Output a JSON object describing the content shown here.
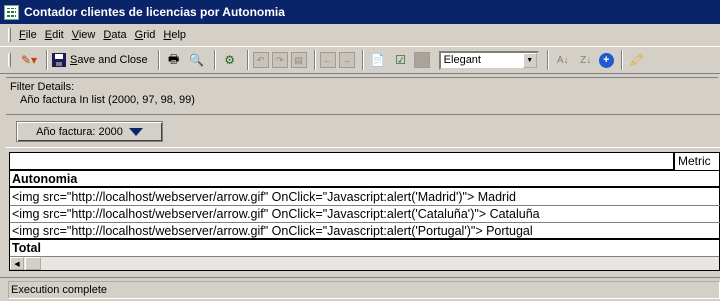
{
  "window": {
    "title": "Contador clientes de licencias por Autonomia"
  },
  "menu": {
    "items": [
      {
        "key": "F",
        "rest": "ile"
      },
      {
        "key": "E",
        "rest": "dit"
      },
      {
        "key": "V",
        "rest": "iew"
      },
      {
        "key": "D",
        "rest": "ata"
      },
      {
        "key": "G",
        "rest": "rid"
      },
      {
        "key": "H",
        "rest": "elp"
      }
    ]
  },
  "toolbar": {
    "save_close_key": "S",
    "save_close_rest": "ave and Close",
    "style_value": "Elegant"
  },
  "filter": {
    "label": "Filter Details:",
    "value": "Año factura In list (2000, 97, 98, 99)"
  },
  "page_by": {
    "label": "Año factura: 2000"
  },
  "grid": {
    "metric_header": "Metric",
    "row_header": "Autonomia",
    "rows": [
      "<img src=\"http://localhost/webserver/arrow.gif\" OnClick=\"Javascript:alert('Madrid')\"> Madrid",
      "<img src=\"http://localhost/webserver/arrow.gif\" OnClick=\"Javascript:alert('Cataluña')\"> Cataluña",
      "<img src=\"http://localhost/webserver/arrow.gif\" OnClick=\"Javascript:alert('Portugal')\"> Portugal"
    ],
    "total_label": "Total"
  },
  "status": {
    "text": "Execution complete"
  }
}
